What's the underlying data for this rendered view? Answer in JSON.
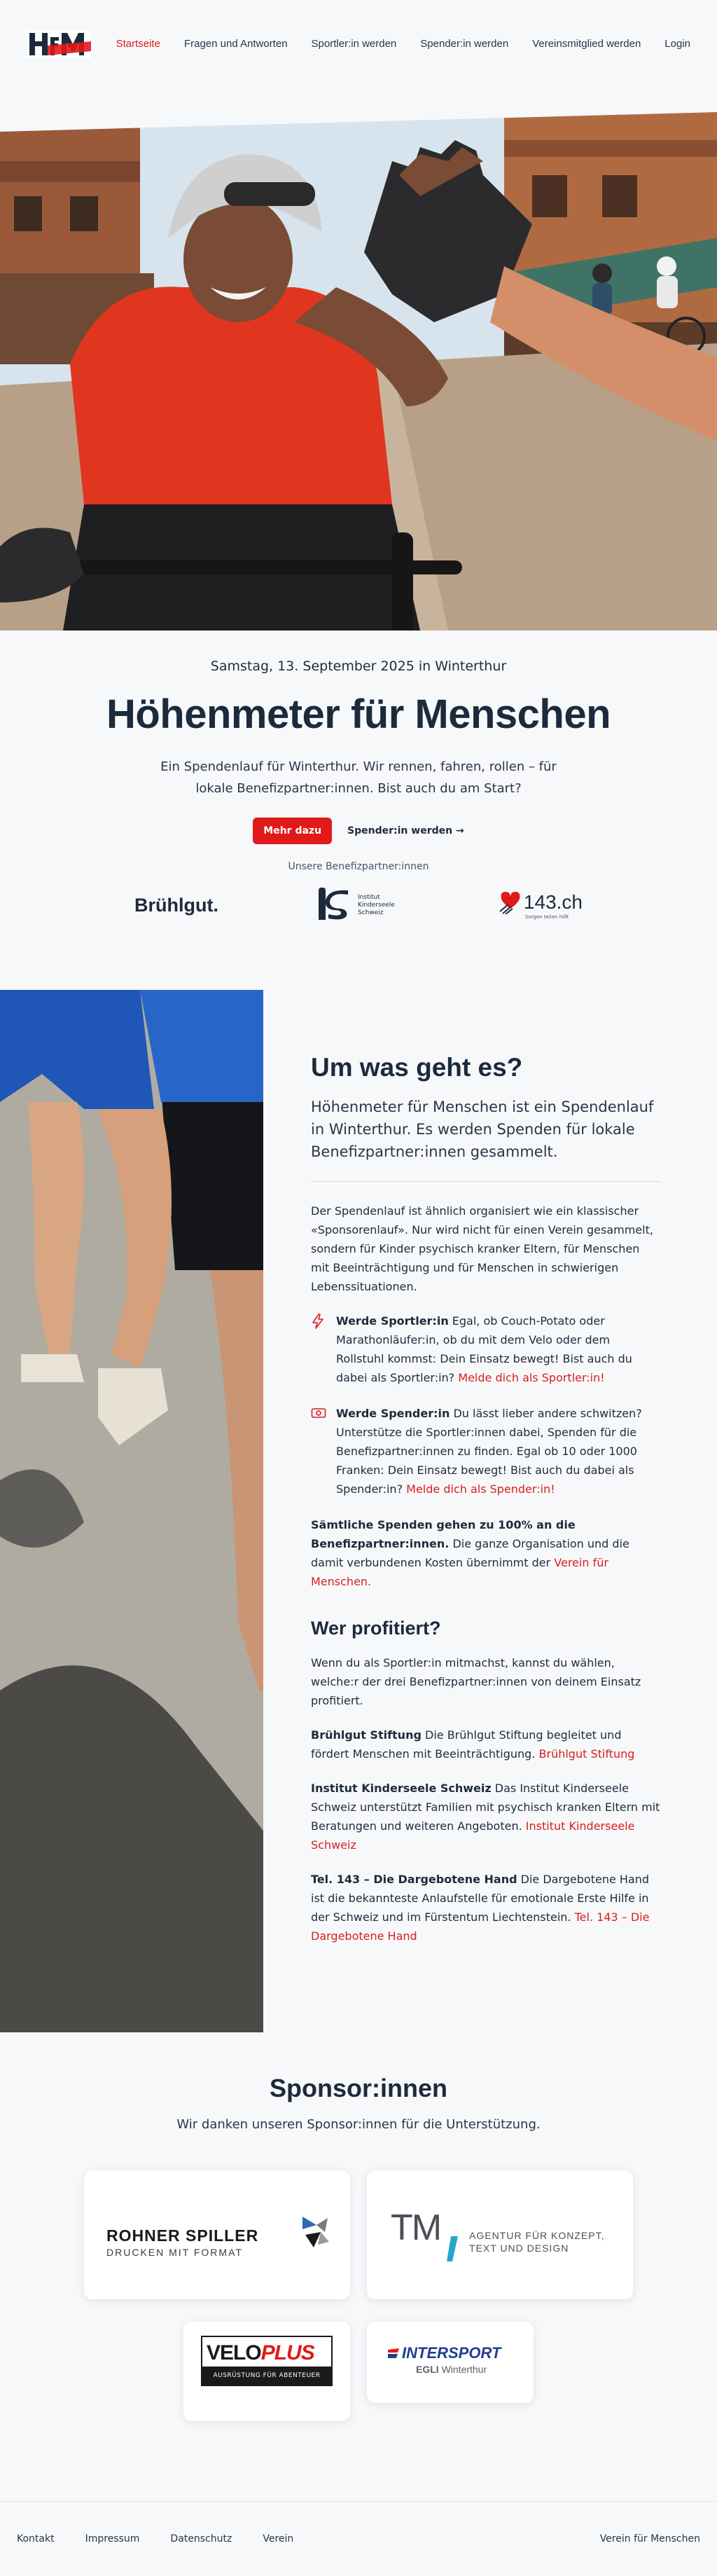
{
  "header": {
    "logo_text": "HfM",
    "nav": [
      {
        "label": "Startseite",
        "active": true
      },
      {
        "label": "Fragen und Antworten",
        "active": false
      },
      {
        "label": "Sportler:in werden",
        "active": false
      },
      {
        "label": "Spender:in werden",
        "active": false
      },
      {
        "label": "Vereinsmitglied werden",
        "active": false
      },
      {
        "label": "Login",
        "active": false
      }
    ]
  },
  "hero": {
    "image": "cyclist-high-five-photo"
  },
  "intro": {
    "date": "Samstag, 13. September 2025 in Winterthur",
    "title": "Höhenmeter für Menschen",
    "lead": "Ein Spendenlauf für Winterthur. Wir rennen, fahren, rollen – für lokale Benefizpartner:innen. Bist auch du am Start?",
    "primary_cta": "Mehr dazu",
    "secondary_cta": "Spender:in werden →",
    "partners_caption": "Unsere Benefizpartner:innen",
    "partners": [
      {
        "name": "Brühlgut."
      },
      {
        "name": "is",
        "sub": "Institut Kinderseele Schweiz"
      },
      {
        "name": "143.ch",
        "sub": "Sorgen teilen hilft"
      }
    ]
  },
  "about": {
    "image": "runners-legs-photo",
    "title": "Um was geht es?",
    "lead": "Höhenmeter für Menschen ist ein Spendenlauf in Winterthur. Es werden Spenden für lokale Benefizpartner:innen gesammelt.",
    "body": "Der Spendenlauf ist ähnlich organisiert wie ein klassischer «Sponsorenlauf». Nur wird nicht für einen Verein gesammelt, sondern für Kinder psychisch kranker Eltern, für Menschen mit Beeinträchtigung und für Menschen in schwierigen Lebenssituationen.",
    "features": [
      {
        "icon": "lightning-icon",
        "title": "Werde Sportler:in",
        "text": " Egal, ob Couch-Potato oder Marathonläufer:in, ob du mit dem Velo oder dem Rollstuhl kommst: Dein Einsatz bewegt! Bist auch du dabei als Sportler:in? ",
        "link": "Melde dich als Sportler:in!"
      },
      {
        "icon": "money-icon",
        "title": "Werde Spender:in",
        "text": " Du lässt lieber andere schwitzen? Unterstütze die Sportler:innen dabei, Spenden für die Benefizpartner:innen zu finden. Egal ob 10 oder 1000 Franken: Dein Einsatz bewegt! Bist auch du dabei als Spender:in? ",
        "link": "Melde dich als Spender:in!"
      }
    ],
    "donation_title": "Sämtliche Spenden gehen zu 100% an die Benefizpartner:innen.",
    "donation_text": " Die ganze Organisation und die damit verbundenen Kosten übernimmt der ",
    "donation_link": "Verein für Menschen.",
    "who_title": "Wer profitiert?",
    "who_intro": "Wenn du als Sportler:in mitmachst, kannst du wählen, welche:r der drei Benefizpartner:innen von deinem Einsatz profitiert.",
    "beneficiaries": [
      {
        "name": "Brühlgut Stiftung",
        "text": " Die Brühlgut Stiftung begleitet und fördert Menschen mit Beeinträchtigung. ",
        "link": "Brühlgut Stiftung"
      },
      {
        "name": "Institut Kinderseele Schweiz",
        "text": " Das Institut Kinderseele Schweiz unterstützt Familien mit psychisch kranken Eltern mit Beratungen und weiteren Angeboten. ",
        "link": "Institut Kinderseele Schweiz"
      },
      {
        "name": "Tel. 143 – Die Dargebotene Hand",
        "text": " Die Dargebotene Hand ist die bekannteste Anlaufstelle für emotionale Erste Hilfe in der Schweiz und im Fürstentum Liechtenstein. ",
        "link": "Tel. 143 – Die Dargebotene Hand"
      }
    ]
  },
  "sponsors": {
    "title": "Sponsor:innen",
    "subtitle": "Wir danken unseren Sponsor:innen für die Unterstützung.",
    "items": [
      {
        "name": "ROHNER SPILLER",
        "tagline": "DRUCKEN MIT FORMAT"
      },
      {
        "name": "TM",
        "tagline1": "AGENTUR FÜR KONZEPT,",
        "tagline2": "TEXT UND DESIGN"
      },
      {
        "name1": "VELO",
        "name2": "PLUS",
        "tagline": "AUSRÜSTUNG FÜR ABENTEUER"
      },
      {
        "name": "INTERSPORT",
        "tagline1": "EGLI",
        "tagline2": "Winterthur"
      }
    ]
  },
  "footer": {
    "links": [
      "Kontakt",
      "Impressum",
      "Datenschutz",
      "Verein"
    ],
    "right": "Verein für Menschen"
  },
  "colors": {
    "accent": "#e01919",
    "text": "#1c2a3d",
    "background": "#f7f8fa"
  }
}
